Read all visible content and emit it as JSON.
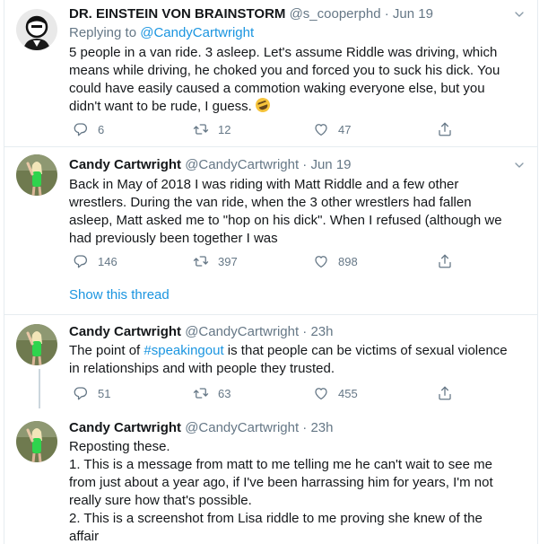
{
  "tweets": [
    {
      "name": "DR. EINSTEIN VON BRAINSTORM",
      "handle": "@s_cooperphd",
      "dot": "·",
      "time": "Jun 19",
      "replying_prefix": "Replying to ",
      "replying_handle": "@CandyCartwright",
      "text_lines": [
        "5 people in a van ride. 3 asleep. Let's assume Riddle was driving, which",
        "means while driving, he choked you and forced you to suck his dick. You",
        "could have easily caused a commotion waking everyone else, but you",
        "didn't want to be rude, I guess. "
      ],
      "emoji": "rolling-on-floor-laughing-emoji",
      "replies": "6",
      "retweets": "12",
      "likes": "47"
    },
    {
      "name": "Candy Cartwright",
      "handle": "@CandyCartwright",
      "dot": "·",
      "time": "Jun 19",
      "text_lines": [
        "Back in May of 2018 I was riding with Matt Riddle and a few other",
        "wrestlers. During the van ride, when the 3 other wrestlers had fallen",
        "asleep, Matt asked me to \"hop on his dick\". When I refused (although we",
        "had previously been together I was"
      ],
      "replies": "146",
      "retweets": "397",
      "likes": "898",
      "show_thread": "Show this thread"
    },
    {
      "name": "Candy Cartwright",
      "handle": "@CandyCartwright",
      "dot": "·",
      "time": "23h",
      "text_prefix": "The point of ",
      "hashtag": "#speakingout",
      "text_suffix": " is that people can be victims of sexual violence",
      "text_line2": "in relationships and with people they trusted.",
      "replies": "51",
      "retweets": "63",
      "likes": "455"
    },
    {
      "name": "Candy Cartwright",
      "handle": "@CandyCartwright",
      "dot": "·",
      "time": "23h",
      "text_lines": [
        "Reposting these.",
        "1. This is a message from matt to me telling me he can't wait to see me",
        "from just about a year ago, if I've been harrassing him for years, I'm not",
        "really sure how that's possible.",
        "2. This is a screenshot from Lisa riddle to me proving she knew of the",
        "affair"
      ]
    }
  ],
  "colors": {
    "link": "#1b95e0",
    "muted": "#657786",
    "border": "#e6ecf0",
    "text": "#14171a"
  },
  "icons": {
    "reply": "reply-icon",
    "retweet": "retweet-icon",
    "like": "heart-icon",
    "share": "share-icon",
    "more": "chevron-down-icon"
  }
}
